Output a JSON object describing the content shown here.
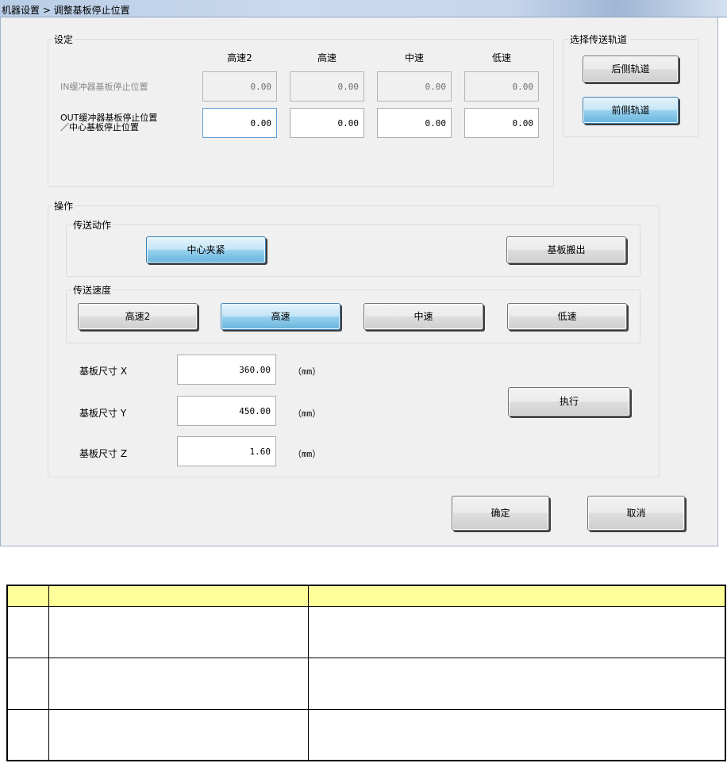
{
  "window": {
    "title": "机器设置 > 调整基板停止位置"
  },
  "settings": {
    "group_title": "设定",
    "speed_headers": [
      "高速2",
      "高速",
      "中速",
      "低速"
    ],
    "in_row": {
      "label": "IN缓冲器基板停止位置",
      "values": [
        "0.00",
        "0.00",
        "0.00",
        "0.00"
      ]
    },
    "out_row": {
      "label_line1": "OUT缓冲器基板停止位置",
      "label_line2": "／中心基板停止位置",
      "values": [
        "0.00",
        "0.00",
        "0.00",
        "0.00"
      ]
    }
  },
  "track": {
    "group_title": "选择传送轨道",
    "rear_label": "后侧轨道",
    "front_label": "前侧轨道",
    "selected": "前侧轨道"
  },
  "operation": {
    "group_title": "操作",
    "transfer_action": {
      "group_title": "传送动作",
      "center_clamp_label": "中心夹紧",
      "unload_label": "基板搬出"
    },
    "transfer_speed": {
      "group_title": "传送速度",
      "options": [
        "高速2",
        "高速",
        "中速",
        "低速"
      ],
      "selected": "高速"
    },
    "size": {
      "x_label": "基板尺寸 X",
      "x_value": "360.00",
      "y_label": "基板尺寸 Y",
      "y_value": "450.00",
      "z_label": "基板尺寸 Z",
      "z_value": "1.60",
      "unit": "（mm）"
    },
    "execute_label": "执行"
  },
  "footer": {
    "ok_label": "确定",
    "cancel_label": "取消"
  },
  "colors": {
    "table_header": "#ffff99",
    "active_button": "#98d1ef"
  }
}
